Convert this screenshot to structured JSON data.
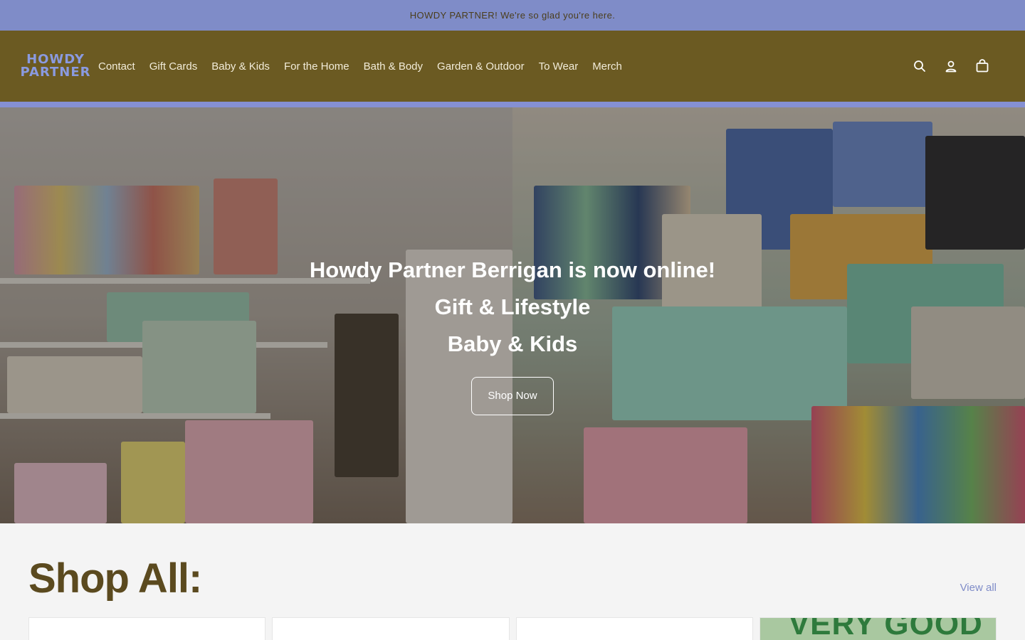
{
  "announcement": {
    "text": "HOWDY PARTNER! We're so glad you're here."
  },
  "logo": {
    "line1": "HOWDY",
    "line2": "PARTNER"
  },
  "nav": {
    "items": [
      {
        "label": "Contact"
      },
      {
        "label": "Gift Cards"
      },
      {
        "label": "Baby & Kids"
      },
      {
        "label": "For the Home"
      },
      {
        "label": "Bath & Body"
      },
      {
        "label": "Garden & Outdoor"
      },
      {
        "label": "To Wear"
      },
      {
        "label": "Merch"
      }
    ]
  },
  "header_icons": [
    "search-icon",
    "account-icon",
    "cart-icon"
  ],
  "hero": {
    "line1": "Howdy Partner Berrigan is now online!",
    "line2": "Gift & Lifestyle",
    "line3": "Baby & Kids",
    "button_label": "Shop Now"
  },
  "collection": {
    "title": "Shop All:",
    "view_all": "View all",
    "card4_text": "VERY GOOD"
  },
  "colors": {
    "announcement_bg": "#7f8cc8",
    "header_bg": "#6b5a22",
    "brand_brown": "#5b4a1f",
    "accent_blue": "#8590d3"
  }
}
